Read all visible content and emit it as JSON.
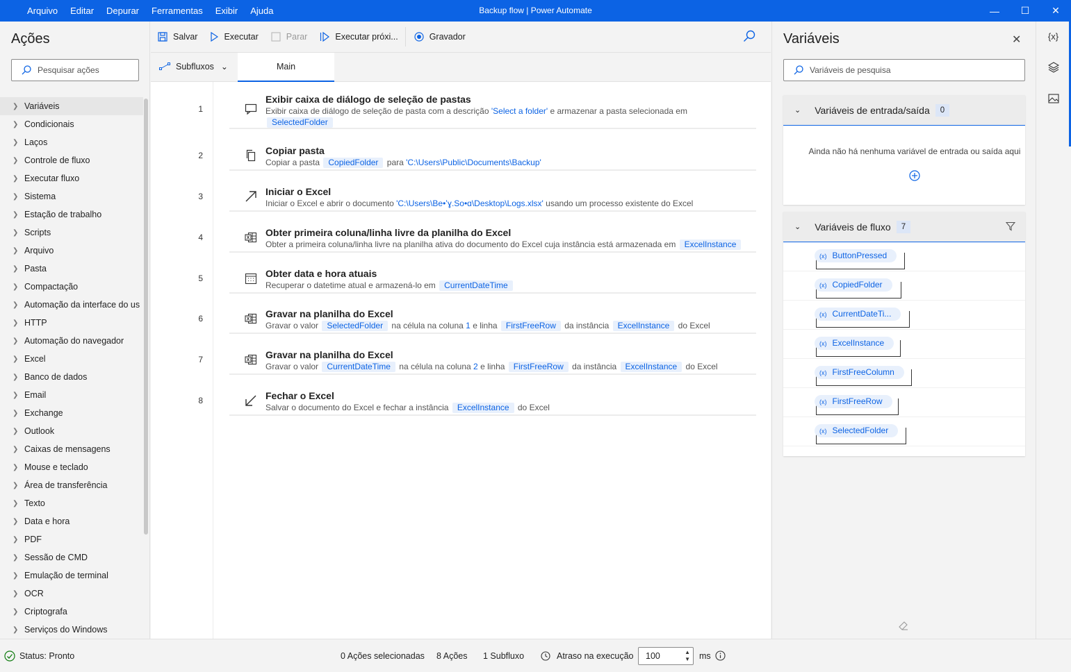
{
  "menu": [
    "Arquivo",
    "Editar",
    "Depurar",
    "Ferramentas",
    "Exibir",
    "Ajuda"
  ],
  "window_title": "Backup flow | Power Automate",
  "actions_panel": {
    "title": "Ações",
    "search_placeholder": "Pesquisar ações",
    "categories": [
      "Variáveis",
      "Condicionais",
      "Laços",
      "Controle de fluxo",
      "Executar fluxo",
      "Sistema",
      "Estação de trabalho",
      "Scripts",
      "Arquivo",
      "Pasta",
      "Compactação",
      "Automação da interface do us",
      "HTTP",
      "Automação do navegador",
      "Excel",
      "Banco de dados",
      "Email",
      "Exchange",
      "Outlook",
      "Caixas de mensagens",
      "Mouse e teclado",
      "Área de transferência",
      "Texto",
      "Data e hora",
      "PDF",
      "Sessão de CMD",
      "Emulação de terminal",
      "OCR",
      "Criptografa",
      "Serviços do Windows"
    ]
  },
  "toolbar": {
    "save": "Salvar",
    "run": "Executar",
    "stop": "Parar",
    "run_next": "Executar próxi...",
    "recorder": "Gravador"
  },
  "tabs": {
    "subflows": "Subfluxos",
    "main": "Main"
  },
  "steps": [
    {
      "num": "1",
      "title": "Exibir caixa de diálogo de seleção de pastas",
      "desc_a": "Exibir caixa de diálogo de seleção de pasta com a descrição ",
      "lit1": "'Select a folder'",
      "desc_b": " e armazenar a pasta selecionada em",
      "tok1": "SelectedFolder"
    },
    {
      "num": "2",
      "title": "Copiar pasta",
      "desc_a": "Copiar a pasta ",
      "tok1": "CopiedFolder",
      "desc_b": " para ",
      "lit1": "'C:\\Users\\Public\\Documents\\Backup'"
    },
    {
      "num": "3",
      "title": "Iniciar o Excel",
      "desc_a": "Iniciar o Excel e abrir o documento ",
      "lit1": "'C:\\Users\\Ве•ʼɣ.Ѕо•ɑ\\Desktop\\Logs.xlsx'",
      "desc_b": " usando um processo existente do Excel"
    },
    {
      "num": "4",
      "title": "Obter primeira coluna/linha livre da planilha do Excel",
      "desc_a": "Obter a primeira coluna/linha livre na planilha ativa do documento do Excel cuja instância está armazenada em ",
      "tok1": "ExcelInstance"
    },
    {
      "num": "5",
      "title": "Obter data e hora atuais",
      "desc_a": "Recuperar o datetime atual e armazená-lo em ",
      "tok1": "CurrentDateTime"
    },
    {
      "num": "6",
      "title": "Gravar na planilha do Excel",
      "desc_a": "Gravar o valor ",
      "tok1": "SelectedFolder",
      "desc_b": " na célula na coluna ",
      "lit1": "1",
      "desc_c": " e linha ",
      "tok2": "FirstFreeRow",
      "desc_d": " da instância ",
      "tok3": "ExcelInstance",
      "desc_e": " do Excel"
    },
    {
      "num": "7",
      "title": "Gravar na planilha do Excel",
      "desc_a": "Gravar o valor ",
      "tok1": "CurrentDateTime",
      "desc_b": " na célula na coluna ",
      "lit1": "2",
      "desc_c": " e linha ",
      "tok2": "FirstFreeRow",
      "desc_d": " da instância ",
      "tok3": "ExcelInstance",
      "desc_e": " do Excel"
    },
    {
      "num": "8",
      "title": "Fechar o Excel",
      "desc_a": "Salvar o documento do Excel e fechar a instância ",
      "tok1": "ExcelInstance",
      "desc_b": " do Excel"
    }
  ],
  "variables_panel": {
    "title": "Variáveis",
    "search_placeholder": "Variáveis de pesquisa",
    "io_section": {
      "title": "Variáveis de entrada/saída",
      "count": "0",
      "empty": "Ainda não há nenhuma variável de entrada ou saída aqui"
    },
    "flow_section": {
      "title": "Variáveis de fluxo",
      "count": "7",
      "items": [
        "ButtonPressed",
        "CopiedFolder",
        "CurrentDateTi...",
        "ExcelInstance",
        "FirstFreeColumn",
        "FirstFreeRow",
        "SelectedFolder"
      ]
    },
    "var_prefix": "(x)"
  },
  "strip": {
    "vars_icon_text": "{x}"
  },
  "statusbar": {
    "status": "Status: Pronto",
    "selected": "0 Ações selecionadas",
    "actions": "8 Ações",
    "subflows": "1 Subfluxo",
    "delay_label": "Atraso na execução",
    "delay_value": "100",
    "unit": "ms"
  },
  "colors": {
    "accent": "#0c63e4",
    "token_bg": "#e8f0fc"
  }
}
